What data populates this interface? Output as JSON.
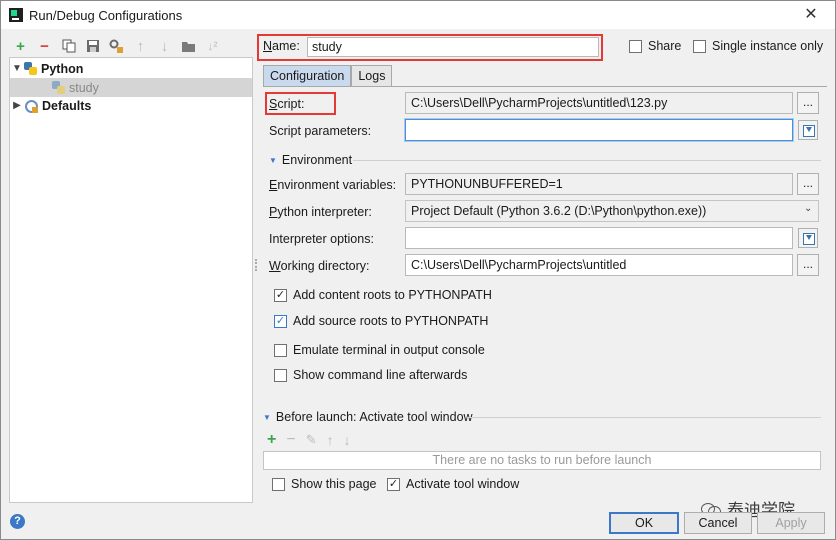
{
  "window": {
    "title": "Run/Debug Configurations",
    "close_glyph": "✕"
  },
  "left_toolbar": {
    "icons": [
      "add-icon",
      "remove-icon",
      "copy-icon",
      "save-icon",
      "edit-defaults-icon",
      "move-up-icon",
      "move-down-icon",
      "folder-icon",
      "sort-icon"
    ],
    "add_glyph": "+",
    "remove_glyph": "−",
    "up_glyph": "↑",
    "down_glyph": "↓",
    "sort_glyph": "↓²"
  },
  "tree": {
    "python_label": "Python",
    "study_label": "study",
    "defaults_label": "Defaults",
    "expanded_glyph": "▼",
    "collapsed_glyph": "▶"
  },
  "header": {
    "name_label": "Name:",
    "name_value": "study",
    "share_label": "Share",
    "single_instance_label": "Single instance only"
  },
  "tabs": [
    {
      "label": "Configuration",
      "active": true
    },
    {
      "label": "Logs",
      "active": false
    }
  ],
  "form": {
    "script_label": "Script:",
    "script_value": "C:\\Users\\Dell\\PycharmProjects\\untitled\\123.py",
    "script_params_label": "Script parameters:",
    "script_params_value": "",
    "environment_section": "Environment",
    "env_vars_label": "Environment variables:",
    "env_vars_value": "PYTHONUNBUFFERED=1",
    "interpreter_label": "Python interpreter:",
    "interpreter_value": "Project Default (Python 3.6.2 (D:\\Python\\python.exe))",
    "interp_options_label": "Interpreter options:",
    "interp_options_value": "",
    "working_dir_label": "Working directory:",
    "working_dir_value": "C:\\Users\\Dell\\PycharmProjects\\untitled",
    "browse_glyph": "...",
    "dropdown_glyph": "⌄",
    "checkboxes": [
      {
        "label": "Add content roots to PYTHONPATH",
        "checked": true
      },
      {
        "label": "Add source roots to PYTHONPATH",
        "checked": true
      },
      {
        "label": "Emulate terminal in output console",
        "checked": false
      },
      {
        "label": "Show command line afterwards",
        "checked": false
      }
    ]
  },
  "before_launch": {
    "section": "Before launch: Activate tool window",
    "empty_text": "There are no tasks to run before launch",
    "add_glyph": "+",
    "remove_glyph": "−",
    "edit_glyph": "✎",
    "up_glyph": "↑",
    "down_glyph": "↓",
    "show_page_label": "Show this page",
    "show_page_checked": false,
    "activate_window_label": "Activate tool window",
    "activate_window_checked": true
  },
  "footer": {
    "help_glyph": "?",
    "ok_label": "OK",
    "cancel_label": "Cancel",
    "apply_label": "Apply",
    "watermark": "泰迪学院"
  },
  "colors": {
    "highlight_box": "#e53935",
    "accent": "#3c78c8",
    "add_green": "#3aa54a",
    "remove_red": "#d63b3b"
  }
}
